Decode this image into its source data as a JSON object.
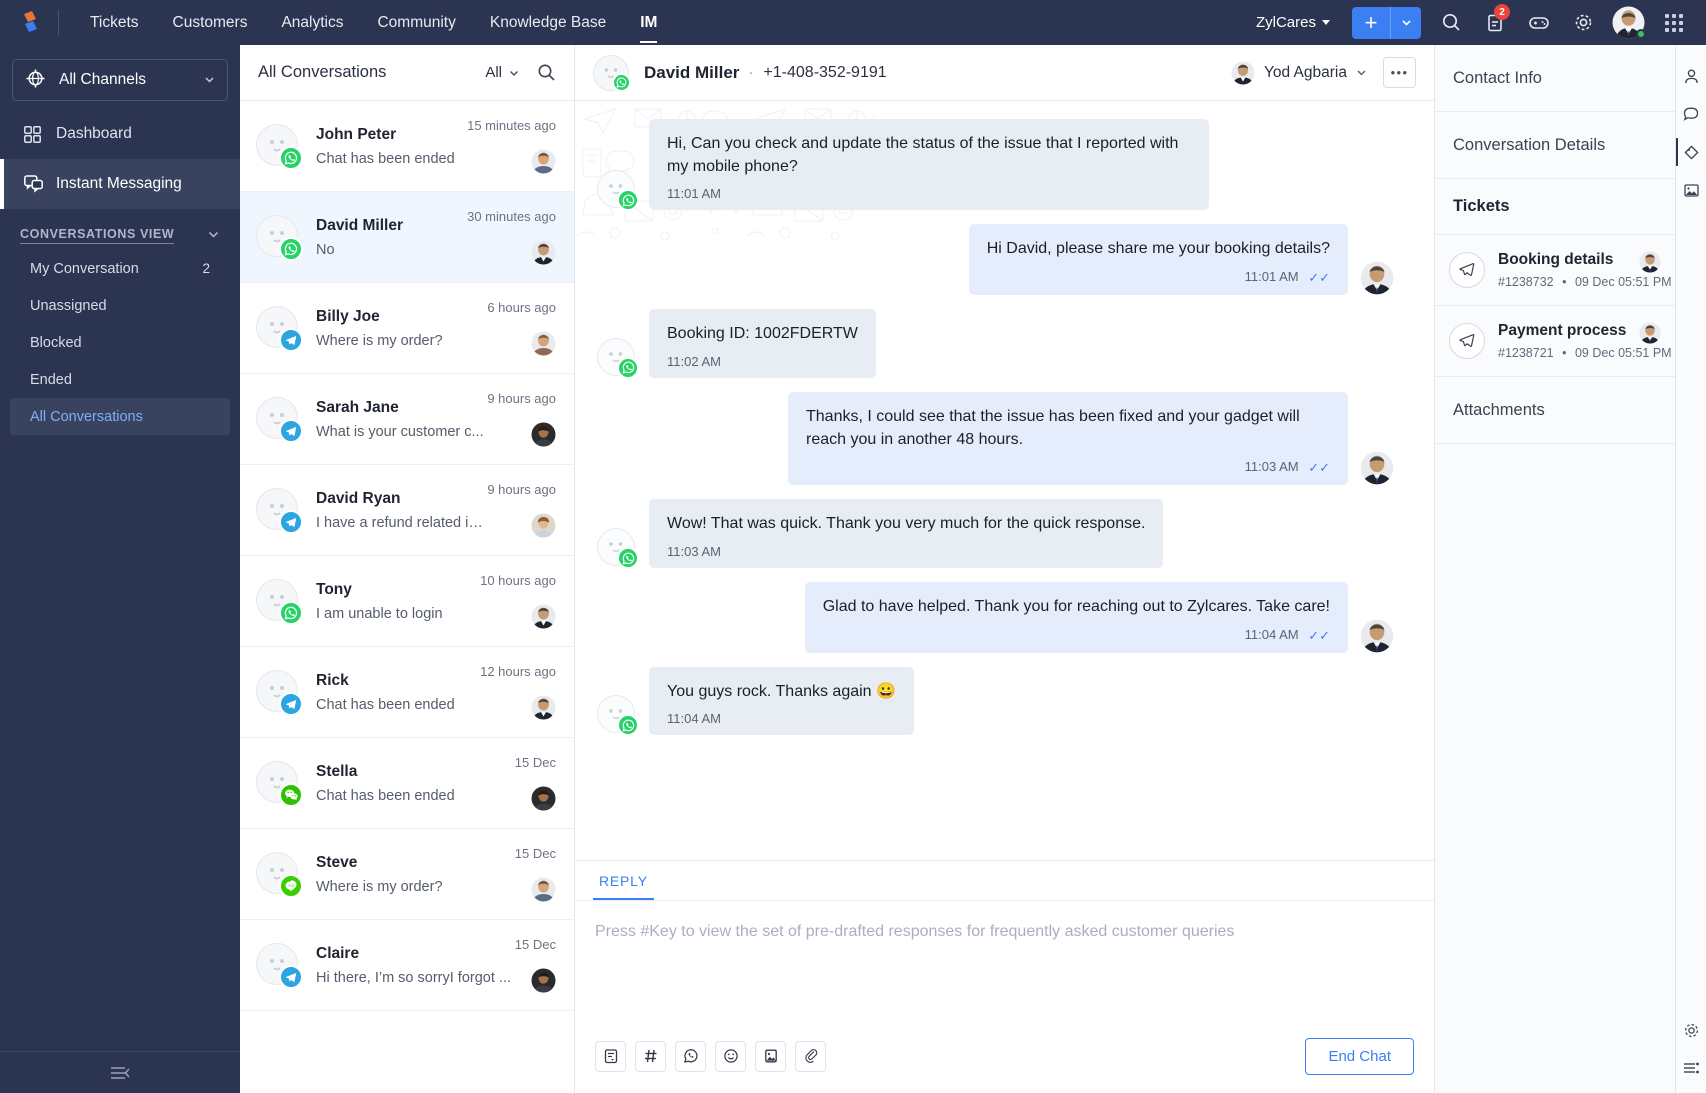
{
  "topbar": {
    "logo_icon": "zoho-desk-logo-icon",
    "nav": [
      {
        "label": "Tickets",
        "active": false
      },
      {
        "label": "Customers",
        "active": false
      },
      {
        "label": "Analytics",
        "active": false
      },
      {
        "label": "Community",
        "active": false
      },
      {
        "label": "Knowledge Base",
        "active": false
      },
      {
        "label": "IM",
        "active": true
      }
    ],
    "org": "ZylCares",
    "add_label": "+",
    "notification_count": "2",
    "icons": [
      "search-icon",
      "notes-icon",
      "gamification-icon",
      "settings-icon",
      "user-avatar",
      "apps-grid-icon"
    ]
  },
  "sidebar": {
    "channel_selector": "All Channels",
    "nav": [
      {
        "label": "Dashboard",
        "icon": "dashboard-icon",
        "active": false
      },
      {
        "label": "Instant Messaging",
        "icon": "chat-bubbles-icon",
        "active": true
      }
    ],
    "section_title": "CONVERSATIONS VIEW",
    "views": [
      {
        "label": "My Conversation",
        "count": "2",
        "selected": false
      },
      {
        "label": "Unassigned",
        "count": "",
        "selected": false
      },
      {
        "label": "Blocked",
        "count": "",
        "selected": false
      },
      {
        "label": "Ended",
        "count": "",
        "selected": false
      },
      {
        "label": "All Conversations",
        "count": "",
        "selected": true
      }
    ],
    "collapse_icon": "collapse-sidebar-icon"
  },
  "conversation_list": {
    "title": "All Conversations",
    "filter": "All",
    "search_icon": "search-icon",
    "items": [
      {
        "name": "John Peter",
        "preview": "Chat has been ended",
        "time": "15 minutes ago",
        "channel": "whatsapp",
        "selected": false
      },
      {
        "name": "David Miller",
        "preview": "No",
        "time": "30 minutes ago",
        "channel": "whatsapp",
        "selected": true
      },
      {
        "name": "Billy Joe",
        "preview": "Where is my order?",
        "time": "6 hours ago",
        "channel": "telegram",
        "selected": false
      },
      {
        "name": "Sarah Jane",
        "preview": "What is your customer c...",
        "time": "9 hours ago",
        "channel": "telegram",
        "selected": false
      },
      {
        "name": "David Ryan",
        "preview": "I have a refund related is...",
        "time": "9 hours ago",
        "channel": "telegram",
        "selected": false
      },
      {
        "name": "Tony",
        "preview": "I am unable to login",
        "time": "10 hours ago",
        "channel": "whatsapp",
        "selected": false
      },
      {
        "name": "Rick",
        "preview": "Chat has been ended",
        "time": "12 hours ago",
        "channel": "telegram",
        "selected": false
      },
      {
        "name": "Stella",
        "preview": "Chat has been ended",
        "time": "15 Dec",
        "channel": "wechat",
        "selected": false
      },
      {
        "name": "Steve",
        "preview": "Where is my order?",
        "time": "15 Dec",
        "channel": "line",
        "selected": false
      },
      {
        "name": "Claire",
        "preview": "Hi there, I’m so sorryI forgot ...",
        "time": "15 Dec",
        "channel": "telegram",
        "selected": false
      }
    ]
  },
  "chat": {
    "contact_name": "David Miller",
    "separator": "·",
    "phone": "+1-408-352-9191",
    "channel": "whatsapp",
    "agent_name": "Yod Agbaria",
    "more_label": "•••",
    "messages": [
      {
        "dir": "in",
        "text": "Hi, Can you check and update the status of the issue that I reported with my mobile phone?",
        "time": "11:01 AM"
      },
      {
        "dir": "out",
        "text": "Hi David, please share me your booking details?",
        "time": "11:01 AM",
        "read": true
      },
      {
        "dir": "in",
        "text": "Booking ID: 1002FDERTW",
        "time": "11:02 AM"
      },
      {
        "dir": "out",
        "text": "Thanks, I could see that the issue has been fixed and your gadget will reach you in another 48 hours.",
        "time": "11:03 AM",
        "read": true
      },
      {
        "dir": "in",
        "text": "Wow! That was quick. Thank you very much for the quick response.",
        "time": "11:03 AM"
      },
      {
        "dir": "out",
        "text": "Glad to have helped. Thank you for reaching out to Zylcares. Take care!",
        "time": "11:04 AM",
        "read": true
      },
      {
        "dir": "in",
        "text": "You guys rock. Thanks again 😀",
        "time": "11:04 AM"
      }
    ]
  },
  "reply": {
    "tab": "REPLY",
    "placeholder": "Press #Key to view the set of pre-drafted responses for frequently asked customer queries",
    "value": "",
    "tools": [
      "canned-response-icon",
      "hash-icon",
      "whatsapp-icon",
      "emoji-icon",
      "image-icon",
      "attachment-icon"
    ],
    "end_chat": "End Chat"
  },
  "right_panel": {
    "sections": [
      {
        "label": "Contact Info",
        "bold": false
      },
      {
        "label": "Conversation Details",
        "bold": false
      }
    ],
    "tickets_title": "Tickets",
    "tickets": [
      {
        "title": "Booking details",
        "id": "#1238732",
        "sep": "•",
        "date": "09 Dec 05:51 PM",
        "icon": "telegram-send-icon"
      },
      {
        "title": "Payment process",
        "id": "#1238721",
        "sep": "•",
        "date": "09 Dec 05:51 PM",
        "icon": "telegram-send-icon"
      }
    ],
    "attachments_title": "Attachments",
    "rail_icons": [
      "contact-person-icon",
      "conversation-icon",
      "tag-icon",
      "media-icon"
    ],
    "rail_bottom_icons": [
      "settings-icon",
      "list-settings-icon"
    ]
  },
  "colors": {
    "nav_bg": "#2b3450",
    "accent": "#3b7ff2",
    "bubble_in": "#e8edf3",
    "bubble_out": "#e5edfc",
    "selected_row": "#eff6fd",
    "whatsapp": "#25d366",
    "telegram": "#2ca5e0",
    "wechat": "#2dc100",
    "line": "#3ace01",
    "badge": "#e8453c"
  }
}
